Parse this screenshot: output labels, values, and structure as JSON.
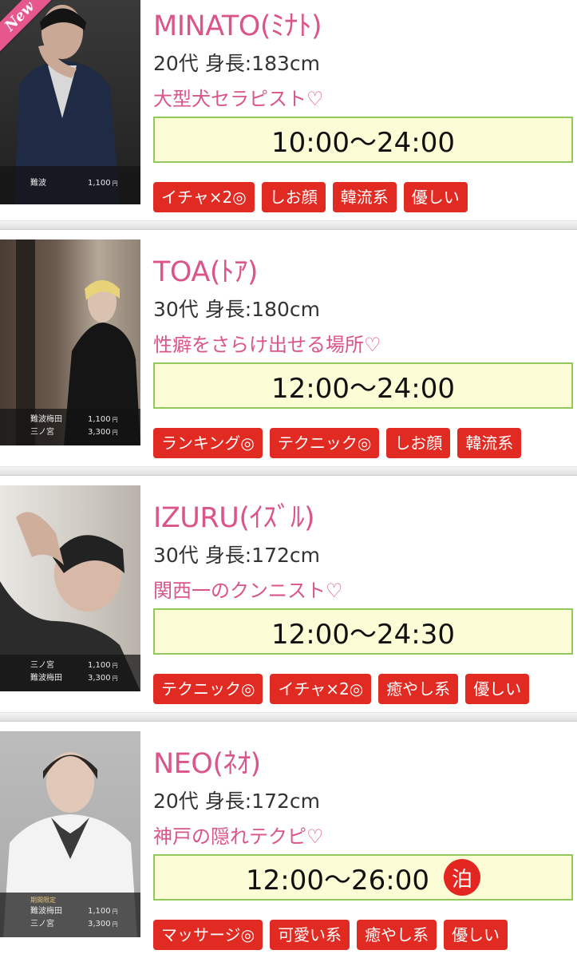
{
  "colors": {
    "accent_pink": "#d9558a",
    "tag_red": "#e02a22",
    "hours_bg": "#fcfdd7",
    "hours_border": "#93c85b"
  },
  "casts": [
    {
      "name": "MINATO(ﾐﾅﾄ)",
      "age_height": "20代 身長:183cm",
      "catchphrase": "大型犬セラピスト♡",
      "hours": "10:00〜24:00",
      "new_badge": "New",
      "prices": [
        {
          "area": "難波",
          "price": "1,100",
          "yen": "円"
        }
      ],
      "tags": [
        "イチャ×2◎",
        "しお顔",
        "韓流系",
        "優しい"
      ]
    },
    {
      "name": "TOA(ﾄｱ)",
      "age_height": "30代 身長:180cm",
      "catchphrase": "性癖をさらけ出せる場所♡",
      "hours": "12:00〜24:00",
      "prices": [
        {
          "area": "難波梅田",
          "price": "1,100",
          "yen": "円"
        },
        {
          "area": "三ノ宮",
          "price": "3,300",
          "yen": "円"
        }
      ],
      "tags": [
        "ランキング◎",
        "テクニック◎",
        "しお顔",
        "韓流系"
      ]
    },
    {
      "name": "IZURU(ｲｽﾞﾙ)",
      "age_height": "30代 身長:172cm",
      "catchphrase": "関西一のクンニスト♡",
      "hours": "12:00〜24:30",
      "prices": [
        {
          "area": "三ノ宮",
          "price": "1,100",
          "yen": "円"
        },
        {
          "area": "難波梅田",
          "price": "3,300",
          "yen": "円"
        }
      ],
      "tags": [
        "テクニック◎",
        "イチャ×2◎",
        "癒やし系",
        "優しい"
      ]
    },
    {
      "name": "NEO(ﾈｵ)",
      "age_height": "20代 身長:172cm",
      "catchphrase": "神戸の隠れテクピ♡",
      "hours": "12:00〜26:00",
      "stay_badge": "泊",
      "limited_label": "期間限定",
      "prices": [
        {
          "area": "難波梅田",
          "price": "1,100",
          "yen": "円"
        },
        {
          "area": "三ノ宮",
          "price": "3,300",
          "yen": "円"
        }
      ],
      "tags": [
        "マッサージ◎",
        "可愛い系",
        "癒やし系",
        "優しい"
      ]
    }
  ]
}
